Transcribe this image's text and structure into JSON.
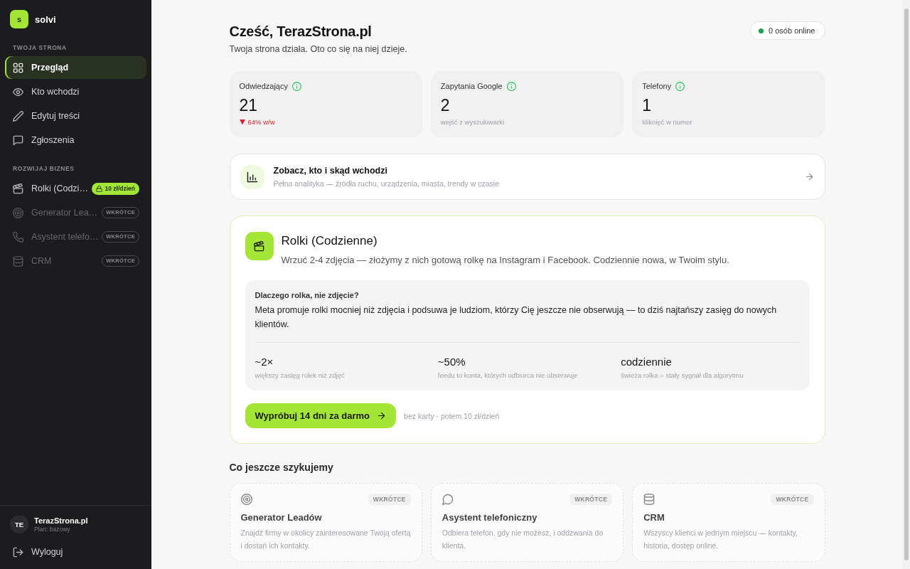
{
  "sidebar": {
    "logo": {
      "mark": "s",
      "name": "solvi"
    },
    "sections": [
      {
        "label": "TWOJA STRONA",
        "items": [
          {
            "label": "Przegląd",
            "selected": true,
            "disabled": false
          },
          {
            "label": "Kto wchodzi",
            "selected": false,
            "disabled": false
          },
          {
            "label": "Edytuj treści",
            "selected": false,
            "disabled": false
          },
          {
            "label": "Zgłoszenia",
            "selected": false,
            "disabled": false
          }
        ]
      },
      {
        "label": "ROZWIJAJ BIZNES",
        "items": [
          {
            "label": "Rolki (Codzi…",
            "selected": false,
            "disabled": false,
            "badge": {
              "kind": "price",
              "text": "10 zł/dzień"
            }
          },
          {
            "label": "Generator Lea…",
            "selected": false,
            "disabled": true,
            "badge": {
              "kind": "soon",
              "text": "WKRÓTCE"
            }
          },
          {
            "label": "Asystent telefo…",
            "selected": false,
            "disabled": true,
            "badge": {
              "kind": "soon",
              "text": "WKRÓTCE"
            }
          },
          {
            "label": "CRM",
            "selected": false,
            "disabled": true,
            "badge": {
              "kind": "soon",
              "text": "WKRÓTCE"
            }
          }
        ]
      }
    ],
    "account": {
      "initials": "TE",
      "name": "TerazStrona.pl",
      "plan": "Plan: bazowy"
    },
    "logout": "Wyloguj"
  },
  "header": {
    "title": "Cześć, TerazStrona.pl",
    "subtitle": "Twoja strona działa. Oto co się na niej dzieje.",
    "online": "0 osób online"
  },
  "stats": [
    {
      "label": "Odwiedzający",
      "value": "21",
      "note": "64% w/w",
      "falling": true
    },
    {
      "label": "Zapytania Google",
      "value": "2",
      "note": "wejść z wyszukiwarki",
      "falling": false
    },
    {
      "label": "Telefony",
      "value": "1",
      "note": "kliknięć w numer",
      "falling": false
    }
  ],
  "analytics_link": {
    "title": "Zobacz, kto i skąd wchodzi",
    "subtitle": "Pełna analityka — źródła ruchu, urządzenia, miasta, trendy w czasie"
  },
  "promo": {
    "title": "Rolki (Codzienne)",
    "description": "Wrzuć 2-4 zdjęcia — złożymy z nich gotową rolkę na Instagram i Facebook. Codziennie nowa, w Twoim stylu.",
    "why": {
      "heading": "Dlaczego rolka, nie zdjęcie?",
      "text": "Meta promuje rolki mocniej niż zdjęcia i podsuwa je ludziom, którzy Cię jeszcze nie obserwują — to dziś najtańszy zasięg do nowych klientów.",
      "facts": [
        {
          "value": "~2×",
          "label": "większy zasięg rolek niż zdjęć"
        },
        {
          "value": "~50%",
          "label": "feedu to konta, których odbiorca nie obserwuje"
        },
        {
          "value": "codziennie",
          "label": "świeża rolka = stały sygnał dla algorytmu"
        }
      ]
    },
    "cta": "Wypróbuj 14 dni za darmo",
    "cta_note": "bez karty · potem 10 zł/dzień"
  },
  "upcoming": {
    "title": "Co jeszcze szykujemy",
    "cards": [
      {
        "badge": "WKRÓTCE",
        "title": "Generator Leadów",
        "text": "Znajdź firmy w okolicy zainteresowane Twoją ofertą i dostań ich kontakty."
      },
      {
        "badge": "WKRÓTCE",
        "title": "Asystent telefoniczny",
        "text": "Odbiera telefon, gdy nie możesz, i oddzwania do klienta."
      },
      {
        "badge": "WKRÓTCE",
        "title": "CRM",
        "text": "Wszyscy klienci w jednym miejscu — kontakty, historia, dostęp online."
      }
    ]
  }
}
